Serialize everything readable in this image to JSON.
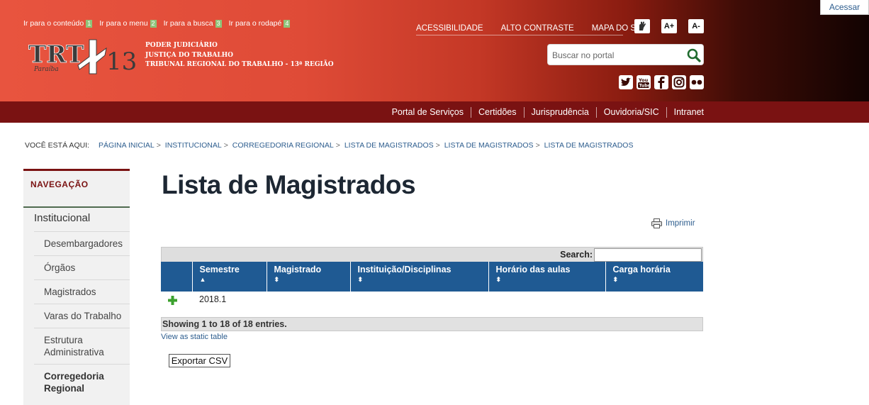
{
  "header": {
    "access_keys": [
      {
        "label": "Ir para o conteúdo",
        "key": "1"
      },
      {
        "label": "Ir para o menu",
        "key": "2"
      },
      {
        "label": "Ir para a busca",
        "key": "3"
      },
      {
        "label": "Ir para o rodapé",
        "key": "4"
      }
    ],
    "logo": {
      "trt": "TRT",
      "number": "13",
      "region": "Paraíba"
    },
    "org_lines": [
      "PODER JUDICIÁRIO",
      "JUSTIÇA DO TRABALHO",
      "TRIBUNAL REGIONAL DO TRABALHO - 13ª REGIÃO"
    ],
    "top_links": [
      "ACESSIBILIDADE",
      "ALTO CONTRASTE",
      "MAPA DO SITE"
    ],
    "font_increase": "A+",
    "font_decrease": "A-",
    "search_placeholder": "Buscar no portal",
    "social_icons": [
      "twitter-icon",
      "youtube-icon",
      "facebook-icon",
      "instagram-icon",
      "flickr-icon"
    ],
    "login_label": "Acessar"
  },
  "navbar": {
    "links": [
      "Portal de Serviços",
      "Certidões",
      "Jurisprudência",
      "Ouvidoria/SIC",
      "Intranet"
    ]
  },
  "breadcrumb": {
    "label": "VOCÊ ESTÁ AQUI:",
    "items": [
      "PÁGINA INICIAL",
      "INSTITUCIONAL",
      "CORREGEDORIA REGIONAL",
      "LISTA DE MAGISTRADOS",
      "LISTA DE MAGISTRADOS",
      "LISTA DE MAGISTRADOS"
    ]
  },
  "sidebar": {
    "title": "NAVEGAÇÃO",
    "section": "Institucional",
    "items": [
      "Desembargadores",
      "Órgãos",
      "Magistrados",
      "Varas do Trabalho",
      "Estrutura Administrativa",
      "Corregedoria Regional"
    ]
  },
  "main": {
    "title": "Lista de Magistrados",
    "print_label": "Imprimir",
    "search_label": "Search:",
    "columns": [
      "Semestre",
      "Magistrado",
      "Instituição/Disciplinas",
      "Horário das aulas",
      "Carga horária"
    ],
    "rows": [
      [
        "2018.1",
        "",
        "",
        "",
        ""
      ]
    ],
    "info": "Showing 1 to 18 of 18 entries.",
    "static_link": "View as static table",
    "export_button": "Exportar CSV"
  },
  "colors": {
    "header_red": "#e8543f",
    "header_dark": "#120302",
    "navbar": "#7a1212",
    "table_header": "#1f5a93",
    "link": "#2d5d8e"
  }
}
